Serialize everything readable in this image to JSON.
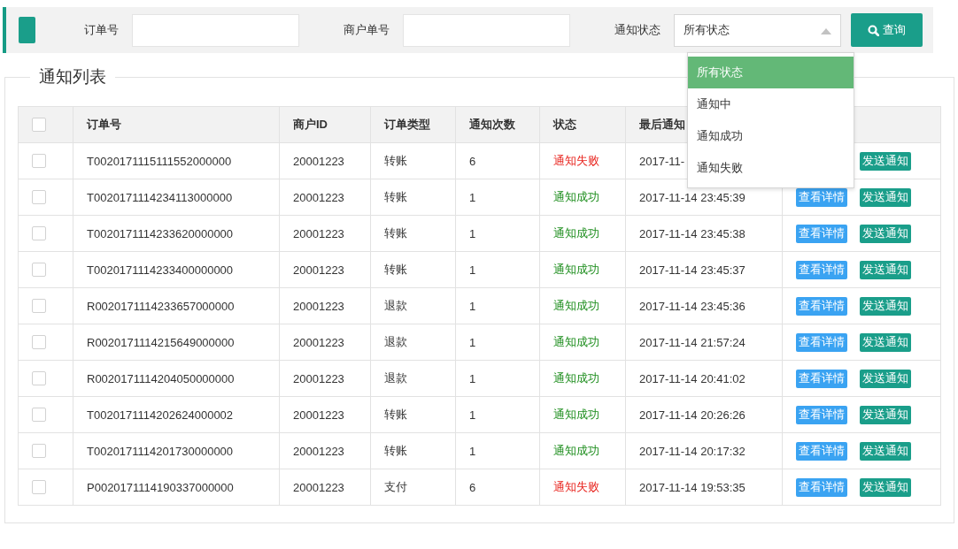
{
  "search_bar": {
    "fields": [
      {
        "label": "订单号"
      },
      {
        "label": "商户单号"
      }
    ],
    "status_filter": {
      "label": "通知状态",
      "value": "所有状态",
      "expanded": true,
      "options": [
        {
          "label": "所有状态",
          "selected": true
        },
        {
          "label": "通知中",
          "selected": false
        },
        {
          "label": "通知成功",
          "selected": false
        },
        {
          "label": "通知失败",
          "selected": false
        }
      ]
    },
    "query_button": "查询"
  },
  "panel": {
    "title": "通知列表",
    "table": {
      "all_checked": false,
      "columns": [
        "订单号",
        "商户ID",
        "订单类型",
        "通知次数",
        "状态",
        "最后通知"
      ],
      "rows": [
        {
          "checked": false,
          "order": "T0020171115111552000000",
          "merchant": "20001223",
          "type": "转账",
          "count": "6",
          "status": "通知失败",
          "kind": "failed",
          "time": "2017-11-",
          "actions": [
            {
              "label": "发送通知",
              "kind": "send"
            }
          ]
        },
        {
          "checked": false,
          "order": "T0020171114234113000000",
          "merchant": "20001223",
          "type": "转账",
          "count": "1",
          "status": "通知成功",
          "kind": "success",
          "time": "2017-11-14 23:45:39",
          "actions": [
            {
              "label": "查看详情",
              "kind": "view"
            },
            {
              "label": "发送通知",
              "kind": "send"
            }
          ]
        },
        {
          "checked": false,
          "order": "T0020171114233620000000",
          "merchant": "20001223",
          "type": "转账",
          "count": "1",
          "status": "通知成功",
          "kind": "success",
          "time": "2017-11-14 23:45:38",
          "actions": [
            {
              "label": "查看详情",
              "kind": "view"
            },
            {
              "label": "发送通知",
              "kind": "send"
            }
          ]
        },
        {
          "checked": false,
          "order": "T0020171114233400000000",
          "merchant": "20001223",
          "type": "转账",
          "count": "1",
          "status": "通知成功",
          "kind": "success",
          "time": "2017-11-14 23:45:37",
          "actions": [
            {
              "label": "查看详情",
              "kind": "view"
            },
            {
              "label": "发送通知",
              "kind": "send"
            }
          ]
        },
        {
          "checked": false,
          "order": "R0020171114233657000000",
          "merchant": "20001223",
          "type": "退款",
          "count": "1",
          "status": "通知成功",
          "kind": "success",
          "time": "2017-11-14 23:45:36",
          "actions": [
            {
              "label": "查看详情",
              "kind": "view"
            },
            {
              "label": "发送通知",
              "kind": "send"
            }
          ]
        },
        {
          "checked": false,
          "order": "R0020171114215649000000",
          "merchant": "20001223",
          "type": "退款",
          "count": "1",
          "status": "通知成功",
          "kind": "success",
          "time": "2017-11-14 21:57:24",
          "actions": [
            {
              "label": "查看详情",
              "kind": "view"
            },
            {
              "label": "发送通知",
              "kind": "send"
            }
          ]
        },
        {
          "checked": false,
          "order": "R0020171114204050000000",
          "merchant": "20001223",
          "type": "退款",
          "count": "1",
          "status": "通知成功",
          "kind": "success",
          "time": "2017-11-14 20:41:02",
          "actions": [
            {
              "label": "查看详情",
              "kind": "view"
            },
            {
              "label": "发送通知",
              "kind": "send"
            }
          ]
        },
        {
          "checked": false,
          "order": "T0020171114202624000002",
          "merchant": "20001223",
          "type": "转账",
          "count": "1",
          "status": "通知成功",
          "kind": "success",
          "time": "2017-11-14 20:26:26",
          "actions": [
            {
              "label": "查看详情",
              "kind": "view"
            },
            {
              "label": "发送通知",
              "kind": "send"
            }
          ]
        },
        {
          "checked": false,
          "order": "T0020171114201730000000",
          "merchant": "20001223",
          "type": "转账",
          "count": "1",
          "status": "通知成功",
          "kind": "success",
          "time": "2017-11-14 20:17:32",
          "actions": [
            {
              "label": "查看详情",
              "kind": "view"
            },
            {
              "label": "发送通知",
              "kind": "send"
            }
          ]
        },
        {
          "checked": false,
          "order": "P0020171114190337000000",
          "merchant": "20001223",
          "type": "支付",
          "count": "6",
          "status": "通知失败",
          "kind": "failed",
          "time": "2017-11-14 19:53:35",
          "actions": [
            {
              "label": "查看详情",
              "kind": "view"
            },
            {
              "label": "发送通知",
              "kind": "send"
            }
          ]
        }
      ]
    }
  }
}
